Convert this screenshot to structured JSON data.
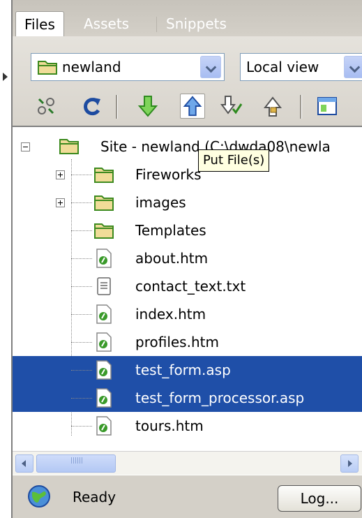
{
  "tabs": [
    {
      "label": "Files",
      "active": true
    },
    {
      "label": "Assets",
      "active": false
    },
    {
      "label": "Snippets",
      "active": false
    }
  ],
  "site_select": {
    "value": "newland"
  },
  "view_select": {
    "value": "Local view"
  },
  "toolbar_icons": [
    "connect-icon",
    "refresh-icon",
    "get-file-icon",
    "put-file-icon",
    "check-out-icon",
    "check-in-icon",
    "expand-icon"
  ],
  "tree": {
    "root": {
      "label": "Site - newland (C:\\dwda08\\newla",
      "icon": "folder-icon"
    },
    "items": [
      {
        "label": "Fireworks",
        "type": "folder",
        "expandable": true,
        "selected": false
      },
      {
        "label": "images",
        "type": "folder",
        "expandable": true,
        "selected": false
      },
      {
        "label": "Templates",
        "type": "folder",
        "expandable": false,
        "selected": false
      },
      {
        "label": "about.htm",
        "type": "htm",
        "expandable": false,
        "selected": false
      },
      {
        "label": "contact_text.txt",
        "type": "txt",
        "expandable": false,
        "selected": false
      },
      {
        "label": "index.htm",
        "type": "htm",
        "expandable": false,
        "selected": false
      },
      {
        "label": "profiles.htm",
        "type": "htm",
        "expandable": false,
        "selected": false
      },
      {
        "label": "test_form.asp",
        "type": "asp",
        "expandable": false,
        "selected": true
      },
      {
        "label": "test_form_processor.asp",
        "type": "asp",
        "expandable": false,
        "selected": true
      },
      {
        "label": "tours.htm",
        "type": "htm",
        "expandable": false,
        "selected": false
      }
    ]
  },
  "tooltip": {
    "text": "Put File(s)"
  },
  "status": {
    "text": "Ready",
    "log_label": "Log..."
  },
  "colors": {
    "selection": "#1f4fa8",
    "folder": "#e8d48a",
    "page_icon": "#3a9a2a",
    "panel": "#d4d0c8"
  }
}
